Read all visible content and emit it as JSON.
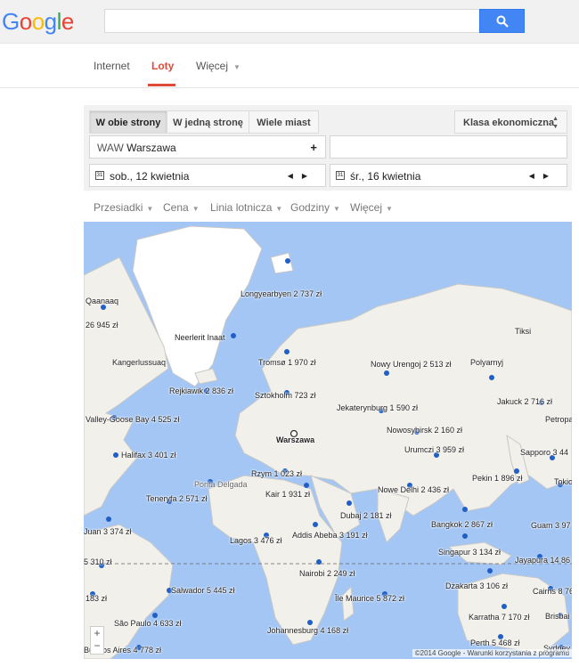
{
  "header": {
    "logo": [
      "G",
      "o",
      "o",
      "g",
      "l",
      "e"
    ],
    "logo_colors": [
      "#4285f4",
      "#ea4335",
      "#fbbc05",
      "#4285f4",
      "#34a853",
      "#ea4335"
    ],
    "search_value": "",
    "search_icon": "search-icon"
  },
  "nav": {
    "tabs": [
      "Internet",
      "Loty",
      "Więcej"
    ]
  },
  "trip": {
    "types": [
      "W obie strony",
      "W jedną stronę",
      "Wiele miast"
    ],
    "class_label": "Klasa ekonomiczna",
    "origin_code": "WAW",
    "origin_city": "Warszawa",
    "origin_add": "+",
    "destination": "",
    "depart": "sob., 12 kwietnia",
    "return": "śr., 16 kwietnia",
    "cal_icon_text": "31"
  },
  "filters": [
    "Przesiadki",
    "Cena",
    "Linia lotnicza",
    "Godziny",
    "Więcej"
  ],
  "map": {
    "labels": [
      "Qaanaaq",
      "Longyearbyen 2 737 zł",
      "Tiksi",
      "26 945 zł",
      "Neerlerit Inaat",
      "Polyarnyj",
      "Kangerlussuaq",
      "Tromsø 1 970 zł",
      "Nowy Urengoj 2 513 zł",
      "Rejkiawik 2 836 zł",
      "Sztokholm 723 zł",
      "Jakuck 2 716 zł",
      "Jekaterynburg 1 590 zł",
      "Valley-Goose Bay 4 525 zł",
      "Petropa",
      "Warszawa",
      "Nowosybirsk 2 160 zł",
      "Urumczi 3 959 zł",
      "Halifax 3 401 zł",
      "Sapporo 3 44",
      "Rzym 1 023 zł",
      "Pekin 1 896 zł",
      "Ponta Delgada",
      "Tokio",
      "Teneryfa 2 571 zł",
      "Kair 1 931 zł",
      "Nowe Delhi 2 436 zł",
      "Dubaj 2 181 zł",
      "Bangkok 2 867 zł",
      "Guam 3 97",
      "Juan 3 374 zł",
      "Addis Abeba 3 191 zł",
      "Lagos 3 476 zł",
      "Singapur 3 134 zł",
      "5 310 zł",
      "Jayapura 14 86",
      "Nairobi 2 249 zł",
      "183 zł",
      "Salwador 5 445 zł",
      "Dżakarta 3 106 zł",
      "Cairns 8 76",
      "Île Maurice 5 872 zł",
      "São Paulo 4 633 zł",
      "Karratha 7 170 zł",
      "Brisbai",
      "Johannesburg 4 168 zł",
      "Perth 5 468 zł",
      "Buenos Aires 4 778 zł",
      "Sydney"
    ],
    "zoom_in": "+",
    "zoom_out": "−",
    "copyright": "©2014 Google - Warunki korzystania z programu"
  },
  "colors": {
    "accent": "#4285f4",
    "active_tab": "#dd4b39",
    "water": "#a3c6f5",
    "land": "#f2f0ea",
    "ice": "#ffffff",
    "dot": "#1f5fc6"
  }
}
